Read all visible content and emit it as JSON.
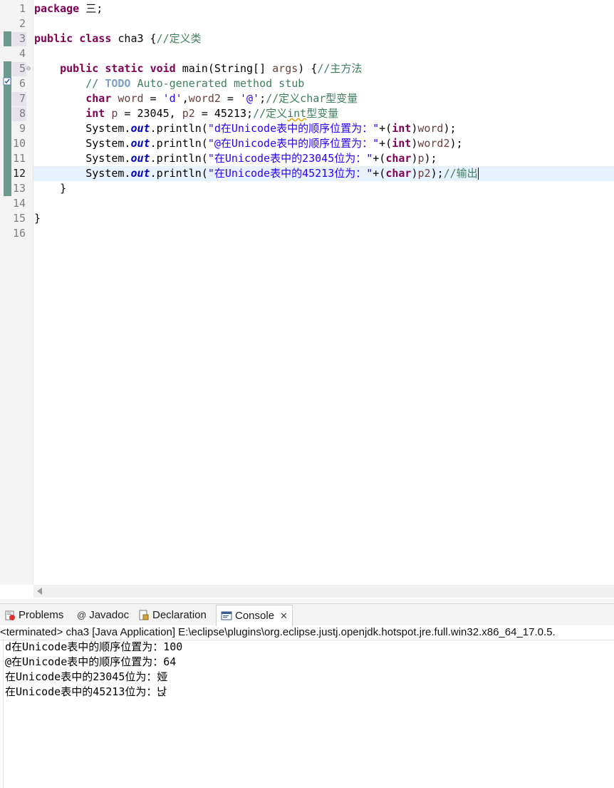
{
  "editor": {
    "line_numbers": [
      "1",
      "2",
      "3",
      "4",
      "5",
      "6",
      "7",
      "8",
      "9",
      "10",
      "11",
      "12",
      "13",
      "14",
      "15",
      "16"
    ],
    "current_line": "12",
    "lines": {
      "l1": {
        "kw": "package",
        "rest": " 三;"
      },
      "l3": {
        "kw1": "public",
        "kw2": "class",
        "name": " cha3 {",
        "comment": "//定义类"
      },
      "l5": {
        "kw1": "public",
        "kw2": "static",
        "kw3": "void",
        "name": " main(String[] ",
        "arg": "args",
        "brace": ") {",
        "comment": "//主方法"
      },
      "l6": {
        "comment_start": "// ",
        "todo": "TODO",
        "comment_rest": " Auto-generated method stub"
      },
      "l7": {
        "kw": "char",
        "v1": " word",
        "eq1": " = ",
        "s1": "'d'",
        "sep": ",",
        "v2": "word2",
        "eq2": " = ",
        "s2": "'@'",
        "semi": ";",
        "comment": "//定义char型变量"
      },
      "l8": {
        "kw": "int",
        "v1": " p",
        "rest1": " = 23045, ",
        "v2": "p2",
        "rest2": " = 45213;",
        "c1": "//定义",
        "c2": "int",
        "c3": "型变量"
      },
      "l9": {
        "pre": "System.",
        "fld": "out",
        "mid": ".println(",
        "str": "\"d在Unicode表中的顺序位置为：\"",
        "plus": "+(",
        "kw": "int",
        "close": ")",
        "var": "word",
        "end": ");"
      },
      "l10": {
        "pre": "System.",
        "fld": "out",
        "mid": ".println(",
        "str": "\"@在Unicode表中的顺序位置为：\"",
        "plus": "+(",
        "kw": "int",
        "close": ")",
        "var": "word2",
        "end": ");"
      },
      "l11": {
        "pre": "System.",
        "fld": "out",
        "mid": ".println(",
        "str": "\"在Unicode表中的23045位为：\"",
        "plus": "+(",
        "kw": "char",
        "close": ")",
        "var": "p",
        "end": ");"
      },
      "l12": {
        "pre": "System.",
        "fld": "out",
        "mid": ".println(",
        "str": "\"在Unicode表中的45213位为：\"",
        "plus": "+(",
        "kw": "char",
        "close": ")",
        "var": "p2",
        "end": ");",
        "comment": "//输出"
      },
      "l13": {
        "text": "}"
      },
      "l15": {
        "text": "}"
      }
    }
  },
  "tabs": {
    "problems": "Problems",
    "javadoc": "Javadoc",
    "declaration": "Declaration",
    "console": "Console",
    "close": "✕"
  },
  "console": {
    "header": "<terminated> cha3 [Java Application] E:\\eclipse\\plugins\\org.eclipse.justj.openjdk.hotspot.jre.full.win32.x86_64_17.0.5.",
    "output": [
      "d在Unicode表中的顺序位置为：100",
      "@在Unicode表中的顺序位置为：64",
      "在Unicode表中的23045位为：娅",
      "在Unicode表中的45213位为：낝"
    ]
  },
  "colors": {
    "keyword": "#7f0055",
    "comment": "#3f7f5f",
    "string": "#2a00ff",
    "field": "#0000c0",
    "current_line": "#e8f2fe",
    "change_bar": "#6c9c90"
  },
  "icons": [
    "fold-minus-icon",
    "task-marker-icon",
    "problems-icon",
    "javadoc-icon",
    "declaration-icon",
    "console-icon",
    "close-icon",
    "scroll-left-icon"
  ]
}
